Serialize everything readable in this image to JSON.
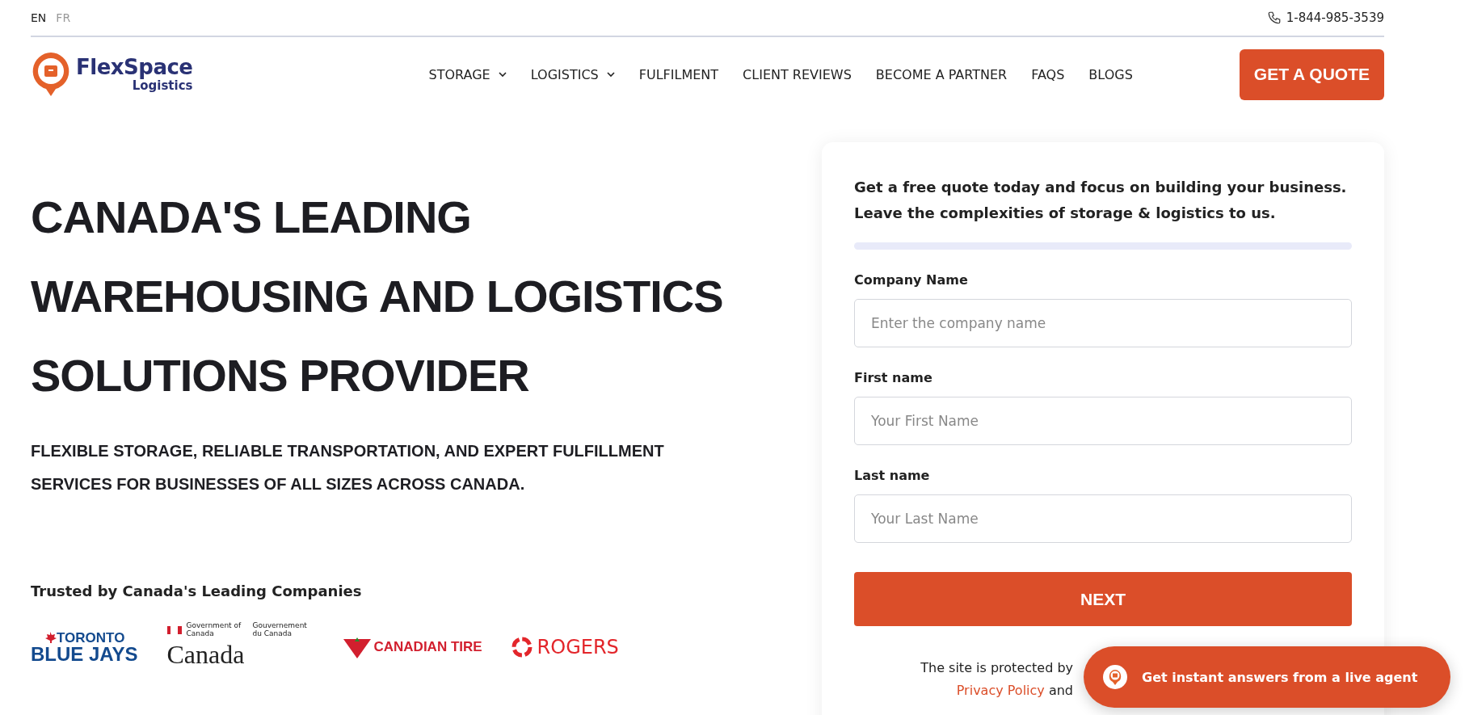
{
  "languages": [
    {
      "label": "EN",
      "selected": true
    },
    {
      "label": "FR",
      "selected": false
    }
  ],
  "phone": "1-844-985-3539",
  "logo": {
    "name": "FlexSpace",
    "sub": "Logistics"
  },
  "nav": [
    {
      "label": "STORAGE",
      "dropdown": true
    },
    {
      "label": "LOGISTICS",
      "dropdown": true
    },
    {
      "label": "FULFILMENT",
      "dropdown": false
    },
    {
      "label": "CLIENT REVIEWS",
      "dropdown": false
    },
    {
      "label": "BECOME A PARTNER",
      "dropdown": false
    },
    {
      "label": "FAQS",
      "dropdown": false
    },
    {
      "label": "BLOGS",
      "dropdown": false
    }
  ],
  "cta": "GET A QUOTE",
  "hero": {
    "title": [
      "CANADA'S LEADING",
      "WAREHOUSING AND LOGISTICS",
      "SOLUTIONS PROVIDER"
    ],
    "subtitle": [
      "FLEXIBLE STORAGE, RELIABLE TRANSPORTATION, AND EXPERT FULFILLMENT",
      "SERVICES FOR BUSINESSES OF ALL SIZES ACROSS CANADA."
    ]
  },
  "trusted": {
    "title": "Trusted by Canada's Leading Companies",
    "logos": [
      {
        "kind": "bluejays",
        "texts": [
          "TORONTO",
          "BLUE JAYS"
        ]
      },
      {
        "kind": "canada",
        "texts": [
          "Government of Canada",
          "Gouvernement du Canada",
          "Canada"
        ]
      },
      {
        "kind": "tire",
        "texts": [
          "CANADIAN TIRE"
        ]
      },
      {
        "kind": "rogers",
        "texts": [
          "ROGERS"
        ]
      }
    ]
  },
  "form": {
    "intro": [
      "Get a free quote today and focus on building your business.",
      "Leave the complexities of storage & logistics to us."
    ],
    "progress": {
      "level": 0
    },
    "fields": [
      {
        "label": "Company Name",
        "placeholder": "Enter the company name"
      },
      {
        "label": "First name",
        "placeholder": "Your First Name"
      },
      {
        "label": "Last name",
        "placeholder": "Your Last Name"
      }
    ],
    "submit": "NEXT",
    "notice": "The site is protected by",
    "link": "Privacy Policy",
    "notice_2": "and"
  },
  "chat": {
    "label": "Get instant answers from a live agent"
  }
}
